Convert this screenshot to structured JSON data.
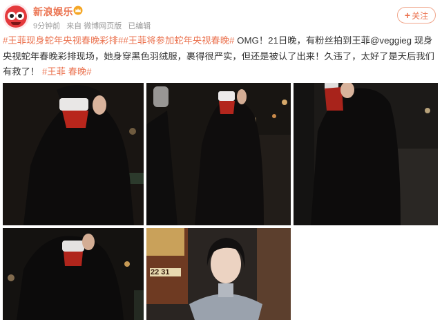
{
  "account": {
    "name": "新浪娱乐",
    "badge_icon": "crown-icon",
    "time": "9分钟前",
    "source": "来自 微博网页版",
    "edited": "已编辑"
  },
  "follow_button": {
    "icon": "plus-icon",
    "label": "关注"
  },
  "post": {
    "tag1": "#王菲现身蛇年央视春晚彩排#",
    "tag2": "#王菲将参加蛇年央视春晚#",
    "body": " OMG！21日晚，有粉丝拍到王菲@veggieg 现身央视蛇年春晚彩排现场，她身穿黑色羽绒服，裹得很严实，但还是被认了出来！久违了，太好了是天后我们有救了！ ",
    "tag3": "#王菲 春晚#"
  },
  "photos": [
    {
      "name": "photo-1",
      "subject": "figure in black down jacket and hood covering face at night"
    },
    {
      "name": "photo-2",
      "subject": "figure in black down jacket with red scarf at night street"
    },
    {
      "name": "photo-3",
      "subject": "figure in black down jacket holding hood at night"
    },
    {
      "name": "photo-4",
      "subject": "figure in black down jacket with hood at night, street lights"
    },
    {
      "name": "photo-5",
      "subject": "woman with short black hair in grey turtleneck, poster behind",
      "poster_text": "22 31"
    }
  ],
  "colors": {
    "accent": "#eb7350",
    "text": "#333333",
    "meta": "#999999"
  }
}
